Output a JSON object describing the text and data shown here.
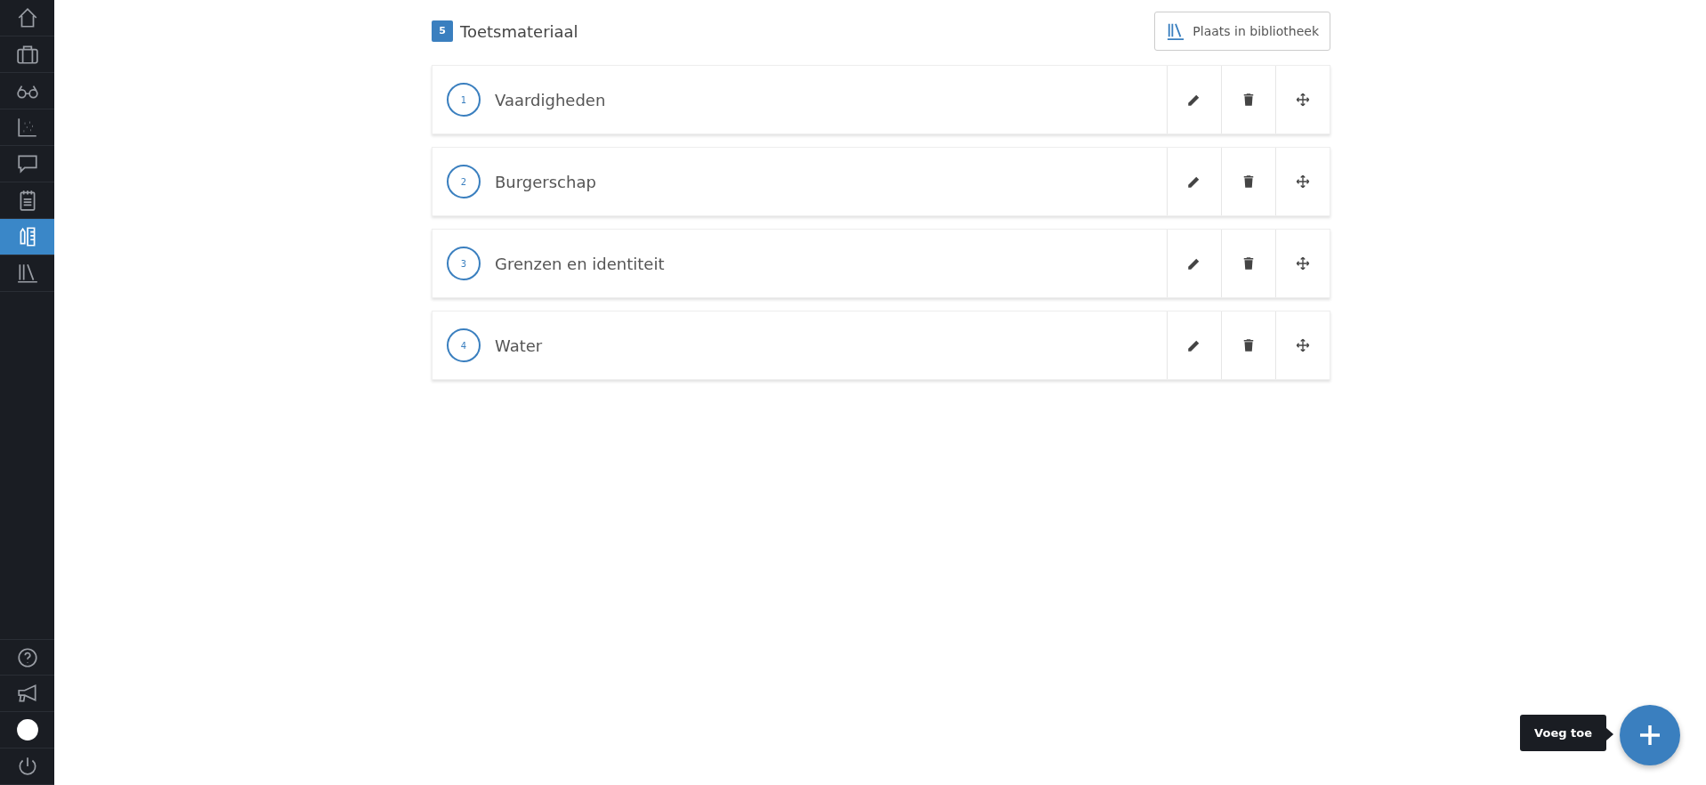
{
  "sidebar": {
    "items": [
      {
        "selected": false
      },
      {
        "selected": false
      },
      {
        "selected": false
      },
      {
        "selected": false
      },
      {
        "selected": false
      },
      {
        "selected": false
      },
      {
        "selected": true
      },
      {
        "selected": false
      }
    ]
  },
  "section": {
    "number": "5",
    "title": "Toetsmateriaal",
    "library_button": "Plaats in bibliotheek"
  },
  "items": [
    {
      "number": "1",
      "title": "Vaardigheden"
    },
    {
      "number": "2",
      "title": "Burgerschap"
    },
    {
      "number": "3",
      "title": "Grenzen en identiteit"
    },
    {
      "number": "4",
      "title": "Water"
    }
  ],
  "add_button": {
    "tooltip": "Voeg toe"
  }
}
